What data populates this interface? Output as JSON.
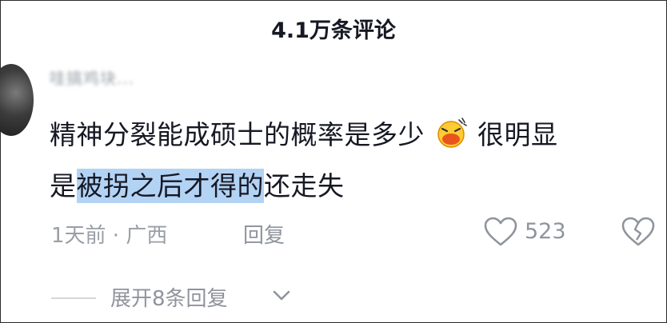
{
  "header": {
    "title": "4.1万条评论"
  },
  "comment": {
    "username": "哇搞鸡块...",
    "line1_text": "精神分裂能成硕士的概率是多少",
    "emoji_icon": "laughing-emoji-icon",
    "line1_suffix": "很明显",
    "line2_prefix": "是",
    "line2_highlight": "被拐之后才得的",
    "line2_suffix": "还走失",
    "highlight_color": "#b3d3f5",
    "date_location": "1天前 · 广西",
    "reply_label": "回复",
    "like_count": "523",
    "like_icon": "heart-outline-icon",
    "dislike_icon": "broken-heart-icon"
  },
  "replies": {
    "expand_label": "展开8条回复",
    "chevron_icon": "chevron-down-icon"
  }
}
